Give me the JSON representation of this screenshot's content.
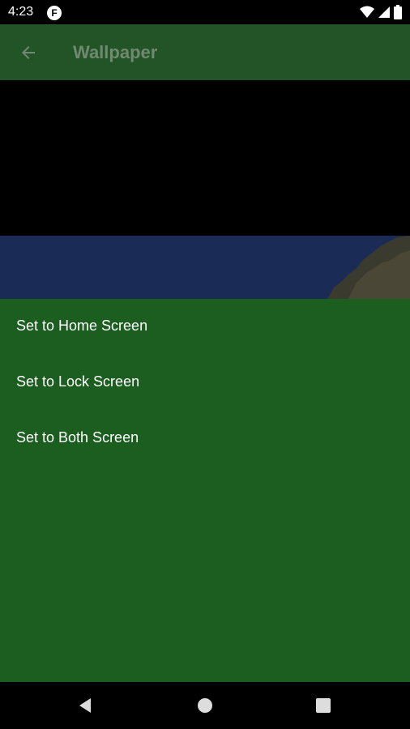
{
  "status_bar": {
    "time": "4:23",
    "app_icon_letter": "F",
    "icons": [
      "wifi-icon",
      "cellular-signal-icon",
      "battery-icon"
    ]
  },
  "app_bar": {
    "title": "Wallpaper",
    "back_icon": "arrow-back-icon",
    "background_color": "#235427",
    "title_color": "#6f8a6f"
  },
  "preview": {
    "description_colors": {
      "letterbox": "#000000",
      "sky": "#1a2b55",
      "mountain": "#3a3a2e"
    }
  },
  "options": {
    "background_color": "#1b5e20",
    "items": [
      {
        "label": "Set to Home Screen"
      },
      {
        "label": "Set to Lock Screen"
      },
      {
        "label": "Set to Both Screen"
      }
    ]
  },
  "nav_bar": {
    "buttons": [
      "back-triangle-icon",
      "home-circle-icon",
      "recents-square-icon"
    ]
  }
}
